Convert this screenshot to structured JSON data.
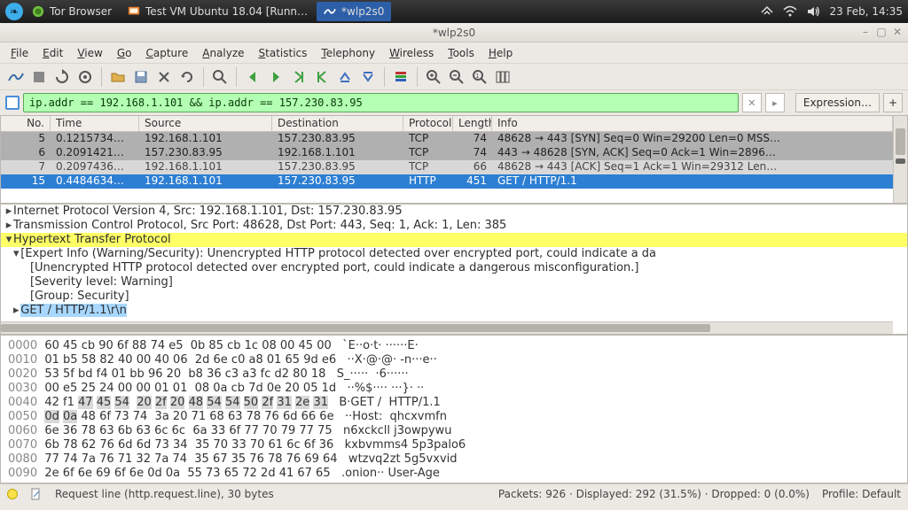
{
  "sys": {
    "app1": "Tor Browser",
    "app2": "Test VM Ubuntu 18.04 [Runn…",
    "app3": "*wlp2s0",
    "clock": "23 Feb, 14:35"
  },
  "window": {
    "title": "*wlp2s0"
  },
  "menu": [
    "File",
    "Edit",
    "View",
    "Go",
    "Capture",
    "Analyze",
    "Statistics",
    "Telephony",
    "Wireless",
    "Tools",
    "Help"
  ],
  "filter": {
    "value": "ip.addr == 192.168.1.101 && ip.addr == 157.230.83.95",
    "clear": "✕",
    "arrow": "▸",
    "expression": "Expression…",
    "plus": "+"
  },
  "columns": [
    "No.",
    "Time",
    "Source",
    "Destination",
    "Protocol",
    "Length",
    "Info"
  ],
  "rows": [
    {
      "no": "5",
      "time": "0.1215734…",
      "src": "192.168.1.101",
      "dst": "157.230.83.95",
      "proto": "TCP",
      "len": "74",
      "info": "48628 → 443 [SYN] Seq=0 Win=29200 Len=0 MSS…",
      "style": "syn"
    },
    {
      "no": "6",
      "time": "0.2091421…",
      "src": "157.230.83.95",
      "dst": "192.168.1.101",
      "proto": "TCP",
      "len": "74",
      "info": "443 → 48628 [SYN, ACK] Seq=0 Ack=1 Win=2896…",
      "style": "syn"
    },
    {
      "no": "7",
      "time": "0.2097436…",
      "src": "192.168.1.101",
      "dst": "157.230.83.95",
      "proto": "TCP",
      "len": "66",
      "info": "48628 → 443 [ACK] Seq=1 Ack=1 Win=29312 Len…",
      "style": "grey"
    },
    {
      "no": "15",
      "time": "0.4484634…",
      "src": "192.168.1.101",
      "dst": "157.230.83.95",
      "proto": "HTTP",
      "len": "451",
      "info": "GET / HTTP/1.1",
      "style": "sel"
    }
  ],
  "details": {
    "l1": "Internet Protocol Version 4, Src: 192.168.1.101, Dst: 157.230.83.95",
    "l2": "Transmission Control Protocol, Src Port: 48628, Dst Port: 443, Seq: 1, Ack: 1, Len: 385",
    "l3": "Hypertext Transfer Protocol",
    "l4": "[Expert Info (Warning/Security): Unencrypted HTTP protocol detected over encrypted port, could indicate a da",
    "l5": "[Unencrypted HTTP protocol detected over encrypted port, could indicate a dangerous misconfiguration.]",
    "l6": "[Severity level: Warning]",
    "l7": "[Group: Security]",
    "l8": "GET / HTTP/1.1\\r\\n"
  },
  "hex": [
    {
      "off": "0000",
      "b": "60 45 cb 90 6f 88 74 e5  0b 85 cb 1c 08 00 45 00",
      "a": "`E··o·t· ······E·"
    },
    {
      "off": "0010",
      "b": "01 b5 58 82 40 00 40 06  2d 6e c0 a8 01 65 9d e6",
      "a": "··X·@·@· -n···e··"
    },
    {
      "off": "0020",
      "b": "53 5f bd f4 01 bb 96 20  b8 36 c3 a3 fc d2 80 18",
      "a": "S_·····  ·6······"
    },
    {
      "off": "0030",
      "b": "00 e5 25 24 00 00 01 01  08 0a cb 7d 0e 20 05 1d",
      "a": "··%$···· ···}· ··"
    },
    {
      "off": "0040",
      "b": "42 f1 47 45 54 20 2f 20  48 54 54 50 2f 31 2e 31",
      "a": "B·GET /  HTTP/1.1",
      "hl": [
        2,
        15
      ]
    },
    {
      "off": "0050",
      "b": "0d 0a 48 6f 73 74 3a 20  71 68 63 78 76 6d 66 6e",
      "a": "··Host:  qhcxvmfn",
      "hl": [
        0,
        1
      ]
    },
    {
      "off": "0060",
      "b": "6e 36 78 63 6b 63 6c 6c  6a 33 6f 77 70 79 77 75",
      "a": "n6xckcll j3owpywu"
    },
    {
      "off": "0070",
      "b": "6b 78 62 76 6d 6d 73 34  35 70 33 70 61 6c 6f 36",
      "a": "kxbvmms4 5p3palo6"
    },
    {
      "off": "0080",
      "b": "77 74 7a 76 71 32 7a 74  35 67 35 76 78 76 69 64",
      "a": "wtzvq2zt 5g5vxvid"
    },
    {
      "off": "0090",
      "b": "2e 6f 6e 69 6f 6e 0d 0a  55 73 65 72 2d 41 67 65",
      "a": ".onion·· User-Age"
    }
  ],
  "status": {
    "left": "Request line (http.request.line), 30 bytes",
    "right": "Packets: 926 · Displayed: 292 (31.5%) · Dropped: 0 (0.0%)",
    "profile": "Profile: Default"
  }
}
